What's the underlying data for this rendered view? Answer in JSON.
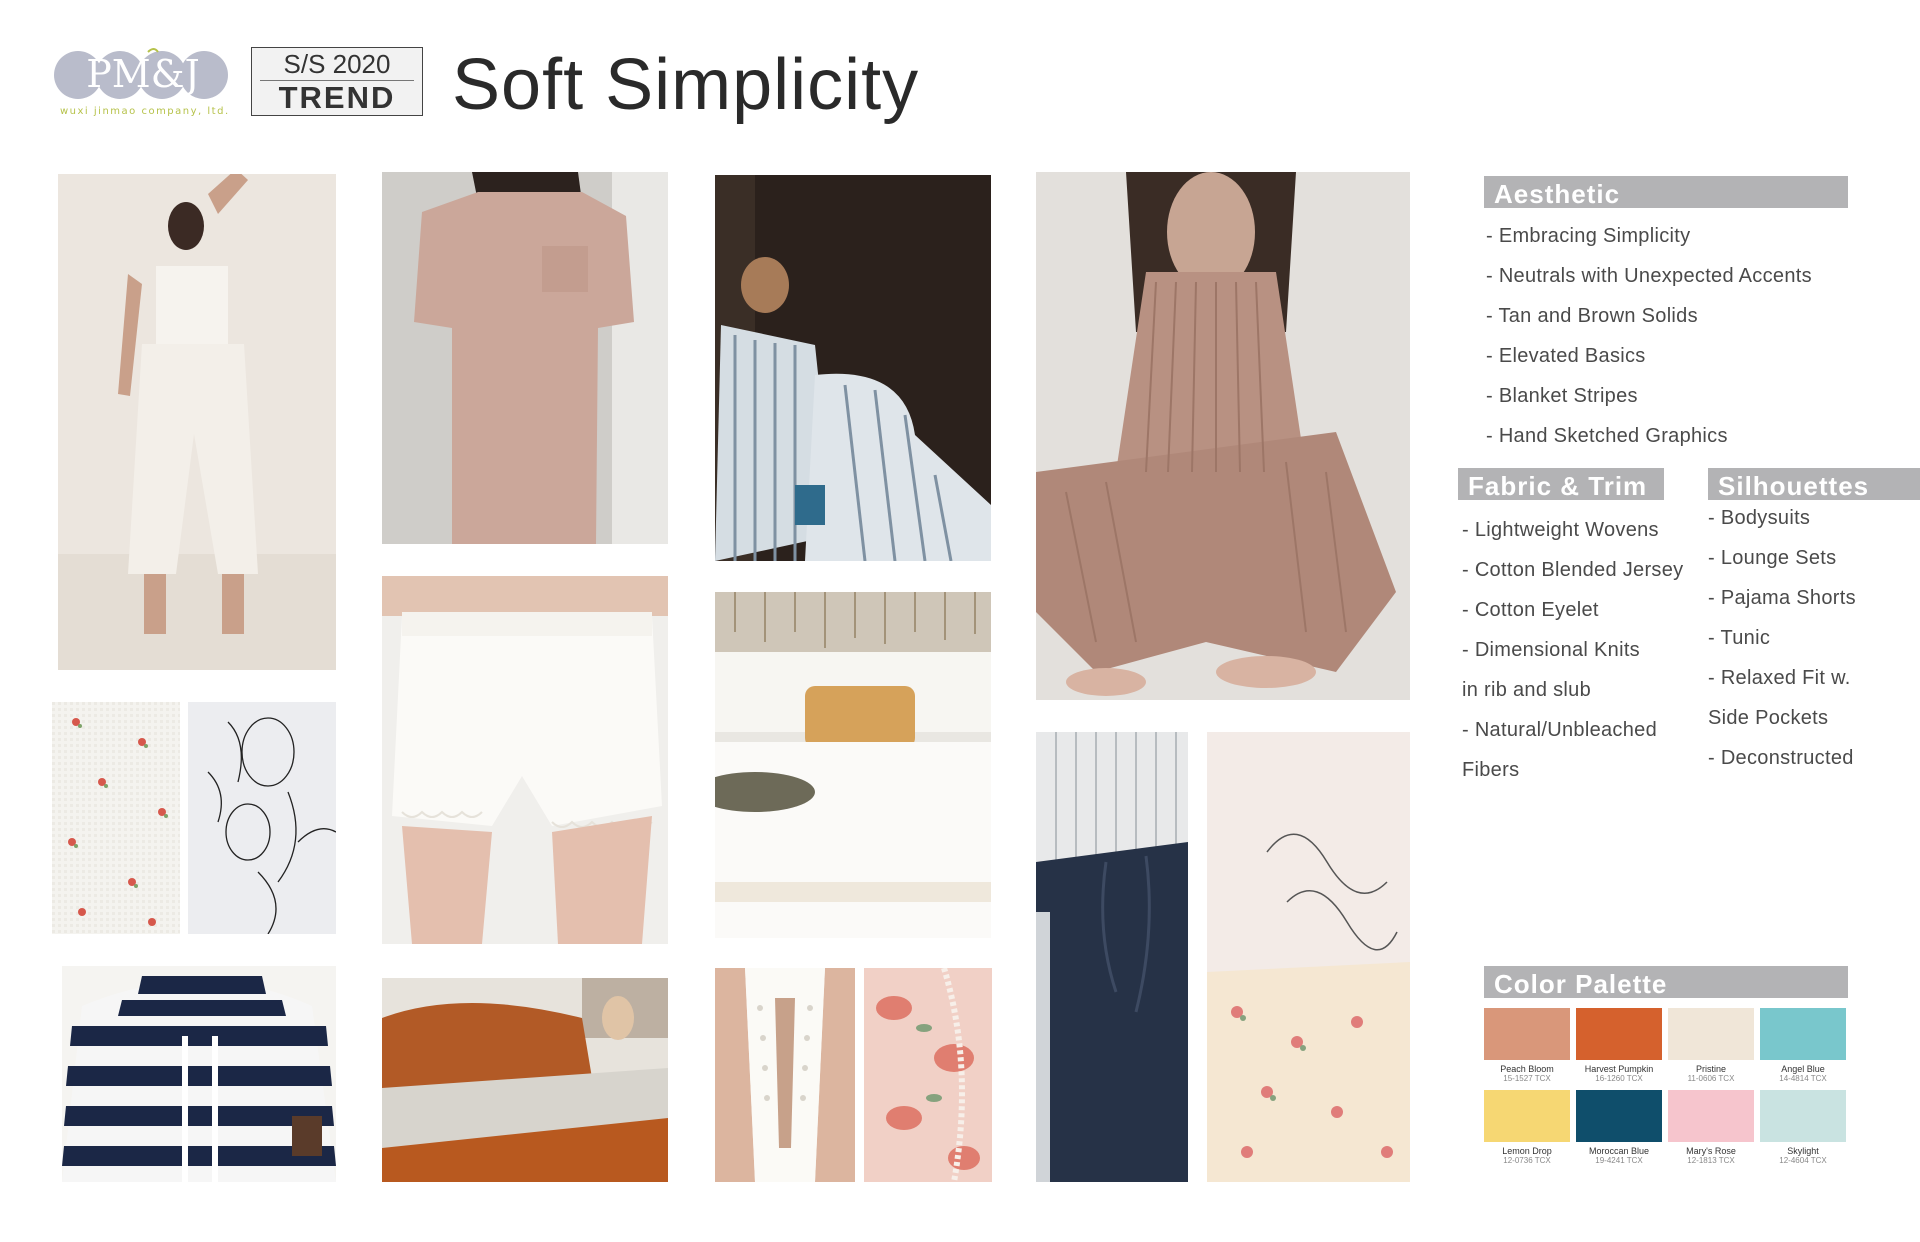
{
  "header": {
    "logo_text": "PM&J",
    "logo_tagline": "wuxi jinmao company, ltd.",
    "season": "S/S 2020",
    "badge": "TREND",
    "title": "Soft Simplicity"
  },
  "aesthetic": {
    "heading": "Aesthetic",
    "items": [
      "- Embracing Simplicity",
      "- Neutrals with Unexpected Accents",
      "- Tan and Brown Solids",
      "- Elevated Basics",
      "- Blanket Stripes",
      "- Hand Sketched Graphics"
    ]
  },
  "fabric_trim": {
    "heading": "Fabric & Trim",
    "items": [
      "- Lightweight Wovens",
      "- Cotton Blended Jersey",
      "- Cotton Eyelet",
      "- Dimensional Knits",
      "in rib and slub",
      "- Natural/Unbleached",
      "Fibers"
    ]
  },
  "silhouettes": {
    "heading": "Silhouettes",
    "items": [
      "- Bodysuits",
      "- Lounge Sets",
      "- Pajama Shorts",
      "- Tunic",
      "- Relaxed Fit w.",
      "Side Pockets",
      "- Deconstructed"
    ]
  },
  "palette": {
    "heading": "Color Palette",
    "colors": [
      {
        "name": "Peach Bloom",
        "code": "15-1527 TCX",
        "hex": "#d9977a"
      },
      {
        "name": "Harvest Pumpkin",
        "code": "16-1260 TCX",
        "hex": "#d5612d"
      },
      {
        "name": "Pristine",
        "code": "11-0606 TCX",
        "hex": "#f0e6d8"
      },
      {
        "name": "Angel Blue",
        "code": "14-4814 TCX",
        "hex": "#79c7cc"
      },
      {
        "name": "Lemon Drop",
        "code": "12-0736 TCX",
        "hex": "#f6d773"
      },
      {
        "name": "Moroccan Blue",
        "code": "19-4241 TCX",
        "hex": "#0f4e6b"
      },
      {
        "name": "Mary's Rose",
        "code": "12-1813 TCX",
        "hex": "#f6c5cd"
      },
      {
        "name": "Skylight",
        "code": "12-4604 TCX",
        "hex": "#c9e3e1"
      }
    ]
  },
  "photos": [
    "white-smocked-pajama-set",
    "tan-pocket-tee",
    "striped-pajama-model",
    "ribbed-knit-lounge-set",
    "floral-waffle-fabric",
    "line-sketch-lemons",
    "white-eyelet-shorts",
    "bedroom-macrame-bedding",
    "navy-stripe-cowl-top",
    "rust-linen-bedding",
    "eyelet-back-top",
    "pink-floral-lace",
    "navy-drawstring-pants",
    "script-tee-floral-shorts"
  ]
}
